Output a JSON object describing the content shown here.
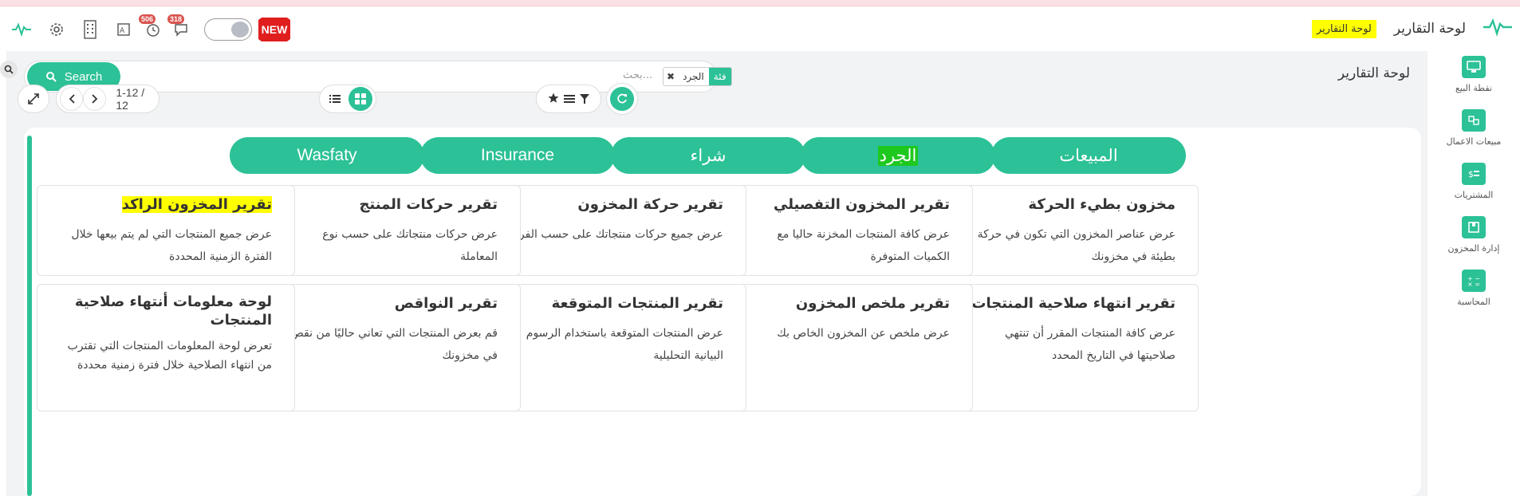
{
  "navbar": {
    "title": "لوحة التقارير",
    "highlight_title": "لوحة التقارير",
    "badge_activity": "506",
    "badge_messages": "318",
    "new_label": "NEW"
  },
  "control_panel": {
    "title": "لوحة التقارير",
    "search_button": "Search",
    "search_placeholder": "بحث...",
    "facet_key": "فئة",
    "facet_value": "الجرد",
    "pager": "1-12 / 12"
  },
  "categories": [
    "المبيعات",
    "الجرد",
    "شراء",
    "Insurance",
    "Wasfaty"
  ],
  "cards": [
    {
      "title": "مخزون بطيء الحركة",
      "desc": "عرض عناصر المخزون التي تكون في حركة بطيئة في مخزونك"
    },
    {
      "title": "تقرير المخزون التفصيلي",
      "desc": "عرض كافة المنتجات المخزنة حاليا مع الكميات المتوفرة"
    },
    {
      "title": "تقرير حركة المخزون",
      "desc": "عرض جميع حركات منتجاتك على حسب الفرع"
    },
    {
      "title": "تقرير حركات المنتج",
      "desc": "عرض حركات منتجاتك على حسب نوع المعاملة"
    },
    {
      "title": "تقرير المخزون الراكد",
      "desc": "عرض جميع المنتجات التي لم يتم بيعها خلال الفترة الزمنية المحددة"
    },
    {
      "title": "تقرير انتهاء صلاحية المنتجات",
      "desc": "عرض كافة المنتجات المقرر أن تنتهي صلاحيتها في التاريخ المحدد"
    },
    {
      "title": "تقرير ملخص المخزون",
      "desc": "عرض ملخص عن المخزون الخاص بك"
    },
    {
      "title": "تقرير المنتجات المتوقعة",
      "desc": "عرض المنتجات المتوقعة باستخدام الرسوم البيانية التحليلية"
    },
    {
      "title": "تقرير النواقص",
      "desc": "قم بعرض المنتجات التي تعاني حاليًا من نقص في مخزونك"
    },
    {
      "title": "لوحة معلومات أنتهاء صلاحية المنتجات",
      "desc": "تعرض لوحة المعلومات المنتجات التي تقترب من انتهاء الصلاحية خلال فترة زمنية محددة"
    }
  ],
  "sidebar": {
    "items": [
      {
        "label": "نقطة البيع",
        "icon": "monitor-icon"
      },
      {
        "label": "مبيعات الاعمال",
        "icon": "handshake-icon"
      },
      {
        "label": "المشتريات",
        "icon": "receipt-icon"
      },
      {
        "label": "إدارة المخزون",
        "icon": "inventory-box-icon"
      },
      {
        "label": "المحاسبة",
        "icon": "calculator-icon"
      }
    ]
  },
  "colors": {
    "accent": "#2cc197",
    "highlight_yellow": "#ffff00",
    "highlight_green": "#1fc81f",
    "new_red": "#e01e1e"
  }
}
